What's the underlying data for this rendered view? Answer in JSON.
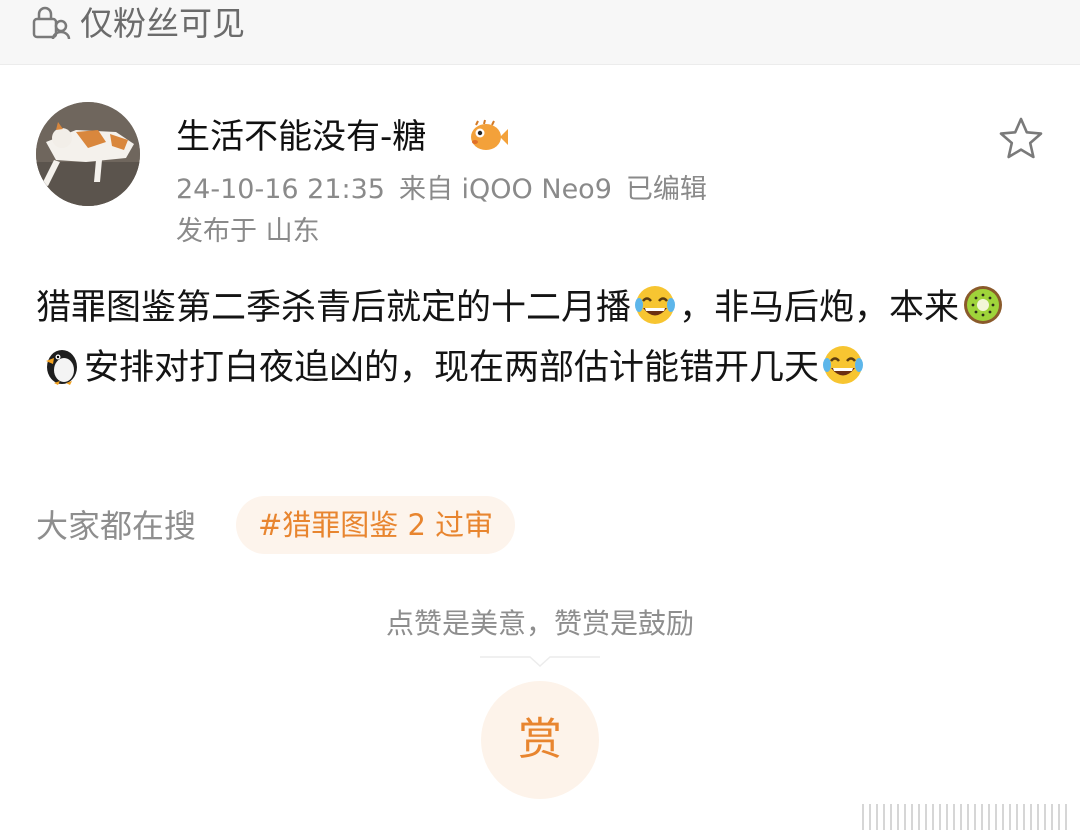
{
  "header": {
    "visibility_label": "仅粉丝可见",
    "icons": [
      "lock-user-icon"
    ]
  },
  "post": {
    "author": {
      "username": "生活不能没有-糖",
      "badge_icon": "pufferfish-icon",
      "avatar": "cat-avatar"
    },
    "timestamp": "24-10-16 21:35",
    "source": "来自 iQOO Neo9",
    "edited": "已编辑",
    "location": "发布于 山东",
    "favorite_icon": "star-icon",
    "body": {
      "part1": "猎罪图鉴第二季杀青后就定的十二月播",
      "part2": "，非马后炮，本来",
      "part3": "安排对打白夜追凶的，现在两部估计能错开几天",
      "emojis": [
        "laugh-cry-emoji",
        "kiwi-emoji",
        "penguin-emoji",
        "laugh-cry-emoji"
      ]
    }
  },
  "trending": {
    "label": "大家都在搜",
    "hashtag": "#猎罪图鉴 2 过审"
  },
  "reward": {
    "caption": "点赞是美意，赞赏是鼓励",
    "button_label": "赏"
  },
  "colors": {
    "accent": "#e8852f",
    "accent_bg": "#fdf4ec",
    "muted_text": "#8e8e8e",
    "header_bg": "#f7f7f7"
  }
}
